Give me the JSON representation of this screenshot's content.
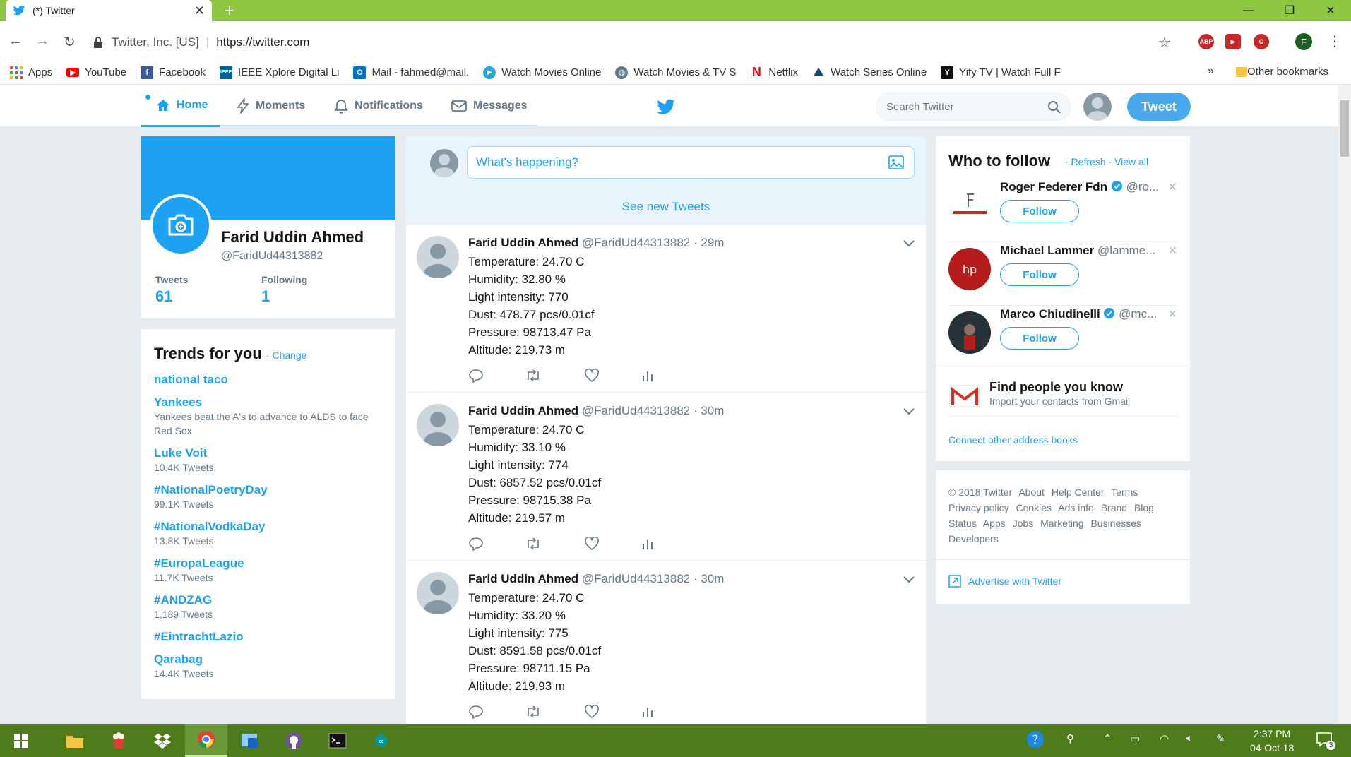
{
  "browser": {
    "tab_title": "(*) Twitter",
    "new_tab": "+",
    "org": "Twitter, Inc. [US]",
    "url": "https://twitter.com",
    "profile_initial": "F",
    "bookmarks": [
      {
        "label": "Apps",
        "icon": "apps-grid-icon",
        "color": "#e94235"
      },
      {
        "label": "YouTube",
        "icon": "youtube-icon",
        "color": "#ff0000"
      },
      {
        "label": "Facebook",
        "icon": "facebook-icon",
        "color": "#3b5998"
      },
      {
        "label": "IEEE Xplore Digital Li",
        "icon": "ieee-icon",
        "color": "#00629b"
      },
      {
        "label": "Mail - fahmed@mail.",
        "icon": "outlook-icon",
        "color": "#0072c6"
      },
      {
        "label": "Watch Movies Online",
        "icon": "play-icon",
        "color": "#26a5d8"
      },
      {
        "label": "Watch Movies & TV S",
        "icon": "globe-icon",
        "color": "#555555"
      },
      {
        "label": "Netflix",
        "icon": "netflix-icon",
        "color": "#e50914"
      },
      {
        "label": "Watch Series Online",
        "icon": "series-icon",
        "color": "#0c4a6e"
      },
      {
        "label": "Yify TV | Watch Full F",
        "icon": "yify-icon",
        "color": "#111111"
      }
    ],
    "bookmarks_more": "»",
    "other_bookmarks": "Other bookmarks"
  },
  "header": {
    "tabs": [
      {
        "label": "Home",
        "icon": "home-icon"
      },
      {
        "label": "Moments",
        "icon": "lightning-icon"
      },
      {
        "label": "Notifications",
        "icon": "bell-icon"
      },
      {
        "label": "Messages",
        "icon": "envelope-icon"
      }
    ],
    "search_placeholder": "Search Twitter",
    "tweet_button": "Tweet"
  },
  "profile": {
    "name": "Farid Uddin Ahmed",
    "handle": "@FaridUd44313882",
    "tweets_label": "Tweets",
    "tweets_count": "61",
    "following_label": "Following",
    "following_count": "1"
  },
  "trends": {
    "title": "Trends for you",
    "change": "· Change",
    "items": [
      {
        "name": "national taco",
        "sub": ""
      },
      {
        "name": "Yankees",
        "sub": "Yankees beat the A's to advance to ALDS to face Red Sox"
      },
      {
        "name": "Luke Voit",
        "sub": "10.4K Tweets"
      },
      {
        "name": "#NationalPoetryDay",
        "sub": "99.1K Tweets"
      },
      {
        "name": "#NationalVodkaDay",
        "sub": "13.8K Tweets"
      },
      {
        "name": "#EuropaLeague",
        "sub": "11.7K Tweets"
      },
      {
        "name": "#ANDZAG",
        "sub": "1,189 Tweets"
      },
      {
        "name": "#EintrachtLazio",
        "sub": ""
      },
      {
        "name": "Qarabag",
        "sub": "14.4K Tweets"
      }
    ]
  },
  "composer": {
    "placeholder": "What's happening?",
    "see_new": "See new Tweets"
  },
  "tweets": [
    {
      "name": "Farid Uddin Ahmed",
      "handle": "@FaridUd44313882",
      "time": "· 29m",
      "lines": [
        "Temperature: 24.70 C",
        "Humidity: 32.80 %",
        "Light intensity: 770",
        "Dust: 478.77 pcs/0.01cf",
        "Pressure: 98713.47 Pa",
        "Altitude: 219.73 m"
      ]
    },
    {
      "name": "Farid Uddin Ahmed",
      "handle": "@FaridUd44313882",
      "time": "· 30m",
      "lines": [
        "Temperature: 24.70 C",
        "Humidity: 33.10 %",
        "Light intensity: 774",
        "Dust: 6857.52 pcs/0.01cf",
        "Pressure: 98715.38 Pa",
        "Altitude: 219.57 m"
      ]
    },
    {
      "name": "Farid Uddin Ahmed",
      "handle": "@FaridUd44313882",
      "time": "· 30m",
      "lines": [
        "Temperature: 24.70 C",
        "Humidity: 33.20 %",
        "Light intensity: 775",
        "Dust: 8591.58 pcs/0.01cf",
        "Pressure: 98711.15 Pa",
        "Altitude: 219.93 m"
      ]
    }
  ],
  "who_to_follow": {
    "title": "Who to follow",
    "refresh": "· Refresh",
    "view_all": "· View all",
    "items": [
      {
        "name": "Roger Federer Fdn",
        "handle": "@ro...",
        "verified": true,
        "follow": "Follow"
      },
      {
        "name": "Michael Lammer",
        "handle": "@lamme...",
        "verified": false,
        "follow": "Follow"
      },
      {
        "name": "Marco Chiudinelli",
        "handle": "@mc...",
        "verified": true,
        "follow": "Follow"
      }
    ],
    "find_title": "Find people you know",
    "find_sub": "Import your contacts from Gmail",
    "connect": "Connect other address books"
  },
  "footer": {
    "links": [
      "© 2018 Twitter",
      "About",
      "Help Center",
      "Terms",
      "Privacy policy",
      "Cookies",
      "Ads info",
      "Brand",
      "Blog",
      "Status",
      "Apps",
      "Jobs",
      "Marketing",
      "Businesses",
      "Developers"
    ],
    "advertise": "Advertise with Twitter"
  },
  "taskbar": {
    "time": "2:37 PM",
    "date": "04-Oct-18",
    "notifications": "3"
  },
  "colors": {
    "twitter_blue": "#1da1f2",
    "chrome_frame": "#8dc63f",
    "taskbar": "#4e7c1b"
  }
}
